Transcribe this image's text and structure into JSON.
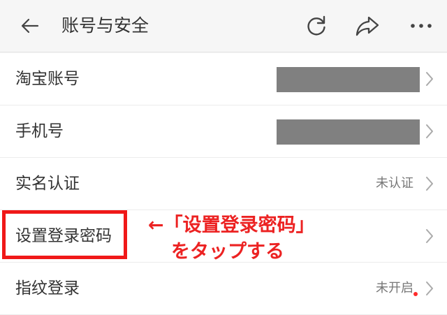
{
  "header": {
    "title": "账号与安全",
    "icons": [
      "back-icon",
      "refresh-icon",
      "share-icon",
      "more-icon"
    ]
  },
  "settings": [
    {
      "label": "淘宝账号",
      "value": "",
      "masked": true
    },
    {
      "label": "手机号",
      "value": "",
      "masked": true
    },
    {
      "label": "实名认证",
      "value": "未认证",
      "masked": false
    },
    {
      "label": "设置登录密码",
      "value": "",
      "masked": false
    },
    {
      "label": "指纹登录",
      "value": "未开启",
      "masked": false
    }
  ],
  "annotation": {
    "line1": "←「设置登录密码」",
    "line2": "をタップする",
    "color": "#ec2222"
  },
  "colors": {
    "background": "#f2f2f2",
    "row_background": "#ffffff",
    "mask": "#808080",
    "highlight": "#f01818"
  }
}
